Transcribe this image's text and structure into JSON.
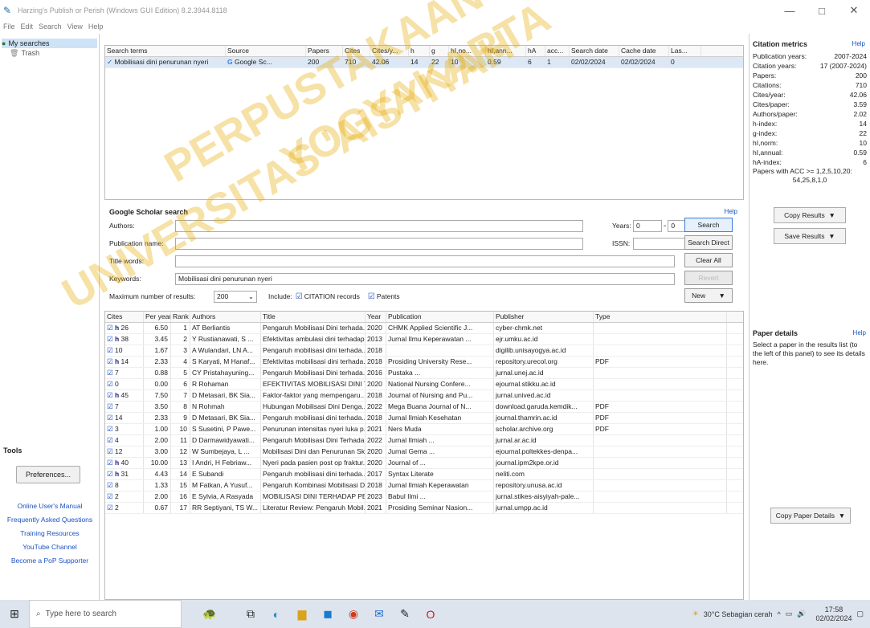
{
  "window": {
    "title": "Harzing's Publish or Perish (Windows GUI Edition) 8.2.3944.8118"
  },
  "menu": [
    "File",
    "Edit",
    "Search",
    "View",
    "Help"
  ],
  "tree": {
    "root": "My searches",
    "child": "Trash"
  },
  "tools": {
    "header": "Tools",
    "preferences": "Preferences...",
    "links": [
      "Online User's Manual",
      "Frequently Asked Questions",
      "Training Resources",
      "YouTube Channel",
      "Become a PoP Supporter"
    ]
  },
  "searches_table": {
    "headers": [
      "Search terms",
      "Source",
      "Papers",
      "Cites",
      "Cites/y...",
      "h",
      "g",
      "hI,no...",
      "hI,ann...",
      "hA",
      "acc...",
      "Search date",
      "Cache date",
      "Las..."
    ],
    "row": [
      "Mobilisasi dini penurunan nyeri",
      "Google Sc...",
      "200",
      "710",
      "42.06",
      "14",
      "22",
      "10",
      "0.59",
      "6",
      "1",
      "02/02/2024",
      "02/02/2024",
      "0"
    ]
  },
  "gs": {
    "header": "Google Scholar search",
    "help": "Help",
    "authors_label": "Authors:",
    "pub_label": "Publication name:",
    "title_label": "Title words:",
    "keywords_label": "Keywords:",
    "keywords_value": "Mobilisasi dini penurunan nyeri",
    "years_label": "Years:",
    "year_from": "0",
    "year_to": "0",
    "issn_label": "ISSN:",
    "max_label": "Maximum number of results:",
    "max_value": "200",
    "include_label": "Include:",
    "citation_label": "CITATION records",
    "patents_label": "Patents",
    "search": "Search",
    "search_direct": "Search Direct",
    "clear_all": "Clear All",
    "revert": "Revert",
    "new": "New"
  },
  "results": {
    "headers": [
      "Cites",
      "Per year",
      "Rank",
      "Authors",
      "Title",
      "Year",
      "Publication",
      "Publisher",
      "Type"
    ],
    "rows": [
      {
        "h": true,
        "cites": "26",
        "per": "6.50",
        "rank": "1",
        "authors": "AT Berliantis",
        "title": "Pengaruh Mobilisasi Dini terhada...",
        "year": "2020",
        "pub": "CHMK Applied Scientific J...",
        "publisher": "cyber-chmk.net",
        "type": ""
      },
      {
        "h": true,
        "cites": "38",
        "per": "3.45",
        "rank": "2",
        "authors": "Y Rustianawati, S ...",
        "title": "Efektivitas ambulasi dini terhadap...",
        "year": "2013",
        "pub": "Jurnal Ilmu Keperawatan ...",
        "publisher": "ejr.umku.ac.id",
        "type": ""
      },
      {
        "h": false,
        "cites": "10",
        "per": "1.67",
        "rank": "3",
        "authors": "A Wulandari, LN A...",
        "title": "Pengaruh mobilisasi dini terhada...",
        "year": "2018",
        "pub": "",
        "publisher": "digilib.unisayogya.ac.id",
        "type": ""
      },
      {
        "h": true,
        "cites": "14",
        "per": "2.33",
        "rank": "4",
        "authors": "S Karyati, M Hanaf...",
        "title": "Efektivitas mobilisasi dini terhada...",
        "year": "2018",
        "pub": "Prosiding University Rese...",
        "publisher": "repository.urecol.org",
        "type": "PDF"
      },
      {
        "h": false,
        "cites": "7",
        "per": "0.88",
        "rank": "5",
        "authors": "CY Pristahayuning...",
        "title": "Pengaruh Mobilisasi Dini terhada...",
        "year": "2016",
        "pub": "Pustaka ...",
        "publisher": "jurnal.unej.ac.id",
        "type": ""
      },
      {
        "h": false,
        "cites": "0",
        "per": "0.00",
        "rank": "6",
        "authors": "R Rohaman",
        "title": "EFEKTIVITAS MOBILISASI DINI TER...",
        "year": "2020",
        "pub": "National Nursing Confere...",
        "publisher": "ejournal.stikku.ac.id",
        "type": ""
      },
      {
        "h": true,
        "cites": "45",
        "per": "7.50",
        "rank": "7",
        "authors": "D Metasari, BK Sia...",
        "title": "Faktor-faktor yang mempengaru...",
        "year": "2018",
        "pub": "Journal of Nursing and Pu...",
        "publisher": "jurnal.unived.ac.id",
        "type": ""
      },
      {
        "h": false,
        "cites": "7",
        "per": "3.50",
        "rank": "8",
        "authors": "N Rohmah",
        "title": "Hubungan Mobilisasi Dini Denga...",
        "year": "2022",
        "pub": "Mega Buana Journal of N...",
        "publisher": "download.garuda.kemdik...",
        "type": "PDF"
      },
      {
        "h": false,
        "cites": "14",
        "per": "2.33",
        "rank": "9",
        "authors": "D Metasari, BK Sia...",
        "title": "Pengaruh mobilisasi dini terhada...",
        "year": "2018",
        "pub": "Jurnal Ilmiah Kesehatan",
        "publisher": "journal.thamrin.ac.id",
        "type": "PDF"
      },
      {
        "h": false,
        "cites": "3",
        "per": "1.00",
        "rank": "10",
        "authors": "S Susetini, P Pawe...",
        "title": "Penurunan intensitas nyeri luka p...",
        "year": "2021",
        "pub": "Ners Muda",
        "publisher": "scholar.archive.org",
        "type": "PDF"
      },
      {
        "h": false,
        "cites": "4",
        "per": "2.00",
        "rank": "11",
        "authors": "D Darmawidyawati...",
        "title": "Pengaruh Mobilisasi Dini Terhada...",
        "year": "2022",
        "pub": "Jurnal Ilmiah ...",
        "publisher": "jurnal.ar.ac.id",
        "type": ""
      },
      {
        "h": false,
        "cites": "12",
        "per": "3.00",
        "rank": "12",
        "authors": "W Sumbejaya, L ...",
        "title": "Mobilisasi Dini dan Penurunan Sk...",
        "year": "2020",
        "pub": "Jurnal Gema ...",
        "publisher": "ejournal.poltekkes-denpa...",
        "type": ""
      },
      {
        "h": true,
        "cites": "40",
        "per": "10.00",
        "rank": "13",
        "authors": "I Andri, H Febriaw...",
        "title": "Nyeri pada pasien post op fraktur...",
        "year": "2020",
        "pub": "Journal of ...",
        "publisher": "journal.ipm2kpe.or.id",
        "type": ""
      },
      {
        "h": true,
        "cites": "31",
        "per": "4.43",
        "rank": "14",
        "authors": "E Subandi",
        "title": "Pengaruh mobilisasi dini terhada...",
        "year": "2017",
        "pub": "Syntax Literate",
        "publisher": "neliti.com",
        "type": ""
      },
      {
        "h": false,
        "cites": "8",
        "per": "1.33",
        "rank": "15",
        "authors": "M Fatkan, A Yusuf...",
        "title": "Pengaruh Kombinasi Mobilisasi D...",
        "year": "2018",
        "pub": "Jurnal Ilmiah Keperawatan",
        "publisher": "repository.unusa.ac.id",
        "type": ""
      },
      {
        "h": false,
        "cites": "2",
        "per": "2.00",
        "rank": "16",
        "authors": "E Sylvia, A Rasyada",
        "title": "MOBILISASI DINI TERHADAP PEN...",
        "year": "2023",
        "pub": "Babul Ilmi ...",
        "publisher": "jurnal.stikes-aisyiyah-pale...",
        "type": ""
      },
      {
        "h": false,
        "cites": "2",
        "per": "0.67",
        "rank": "17",
        "authors": "RR Septiyani, TS W...",
        "title": "Literatur Review: Pengaruh Mobil...",
        "year": "2021",
        "pub": "Prosiding Seminar Nasion...",
        "publisher": "jurnal.umpp.ac.id",
        "type": ""
      }
    ]
  },
  "metrics": {
    "header": "Citation metrics",
    "help": "Help",
    "rows": [
      [
        "Publication years:",
        "2007-2024"
      ],
      [
        "Citation years:",
        "17 (2007-2024)"
      ],
      [
        "Papers:",
        "200"
      ],
      [
        "Citations:",
        "710"
      ],
      [
        "Cites/year:",
        "42.06"
      ],
      [
        "Cites/paper:",
        "3.59"
      ],
      [
        "Authors/paper:",
        "2.02"
      ],
      [
        "h-index:",
        "14"
      ],
      [
        "g-index:",
        "22"
      ],
      [
        "hI,norm:",
        "10"
      ],
      [
        "hI,annual:",
        "0.59"
      ],
      [
        "hA-index:",
        "6"
      ]
    ],
    "acc_label": "Papers with ACC >= 1,2,5,10,20:",
    "acc_value": "54,25,8,1,0",
    "copy": "Copy Results",
    "save": "Save Results"
  },
  "paper_details": {
    "header": "Paper details",
    "help": "Help",
    "text": "Select a paper in the results list (to the left of this panel) to see its details here.",
    "copy": "Copy Paper Details"
  },
  "taskbar": {
    "search": "Type here to search",
    "weather": "30°C Sebagian cerah",
    "time": "17:58",
    "date": "02/02/2024"
  },
  "watermark": [
    "PERPUSTAKAAN",
    "UNIVERSITAS 'AISYIYAH",
    "YOGYAKARTA"
  ]
}
